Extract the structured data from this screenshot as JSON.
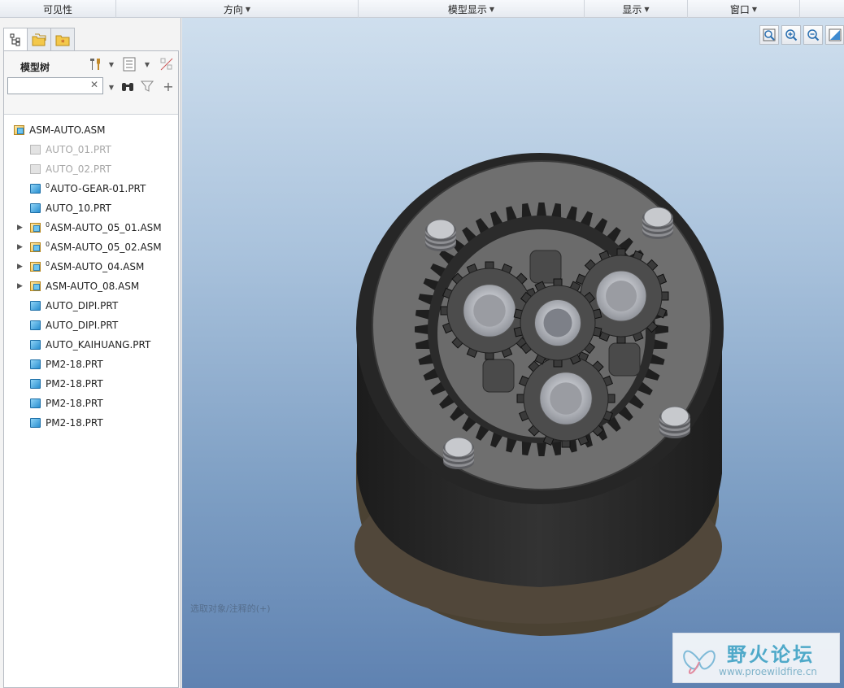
{
  "ribbon": {
    "groups": [
      {
        "label": "可见性",
        "has_dropdown": false
      },
      {
        "label": "方向",
        "has_dropdown": true
      },
      {
        "label": "模型显示",
        "has_dropdown": true
      },
      {
        "label": "显示",
        "has_dropdown": true
      },
      {
        "label": "窗口",
        "has_dropdown": true
      }
    ]
  },
  "sidebar": {
    "tabs": [
      {
        "icon": "model-tree-icon"
      },
      {
        "icon": "folder-browser-icon"
      },
      {
        "icon": "favorites-icon"
      }
    ],
    "tree_title": "模型树",
    "search": {
      "value": "",
      "placeholder": ""
    },
    "tree": [
      {
        "label": "ASM-AUTO.ASM",
        "type": "asm",
        "level": 0,
        "expandable": false,
        "dim": false,
        "marker": ""
      },
      {
        "label": "AUTO_01.PRT",
        "type": "prt",
        "level": 1,
        "expandable": false,
        "dim": true,
        "marker": ""
      },
      {
        "label": "AUTO_02.PRT",
        "type": "prt",
        "level": 1,
        "expandable": false,
        "dim": true,
        "marker": ""
      },
      {
        "label": "AUTO-GEAR-01.PRT",
        "type": "prt",
        "level": 1,
        "expandable": false,
        "dim": false,
        "marker": "0"
      },
      {
        "label": "AUTO_10.PRT",
        "type": "prt",
        "level": 1,
        "expandable": false,
        "dim": false,
        "marker": ""
      },
      {
        "label": "ASM-AUTO_05_01.ASM",
        "type": "asm",
        "level": 1,
        "expandable": true,
        "dim": false,
        "marker": "0"
      },
      {
        "label": "ASM-AUTO_05_02.ASM",
        "type": "asm",
        "level": 1,
        "expandable": true,
        "dim": false,
        "marker": "0"
      },
      {
        "label": "ASM-AUTO_04.ASM",
        "type": "asm",
        "level": 1,
        "expandable": true,
        "dim": false,
        "marker": "0"
      },
      {
        "label": "ASM-AUTO_08.ASM",
        "type": "asm",
        "level": 1,
        "expandable": true,
        "dim": false,
        "marker": ""
      },
      {
        "label": "AUTO_DIPI.PRT",
        "type": "prt",
        "level": 1,
        "expandable": false,
        "dim": false,
        "marker": ""
      },
      {
        "label": "AUTO_DIPI.PRT",
        "type": "prt",
        "level": 1,
        "expandable": false,
        "dim": false,
        "marker": ""
      },
      {
        "label": "AUTO_KAIHUANG.PRT",
        "type": "prt",
        "level": 1,
        "expandable": false,
        "dim": false,
        "marker": ""
      },
      {
        "label": "PM2-18.PRT",
        "type": "prt",
        "level": 1,
        "expandable": false,
        "dim": false,
        "marker": ""
      },
      {
        "label": "PM2-18.PRT",
        "type": "prt",
        "level": 1,
        "expandable": false,
        "dim": false,
        "marker": ""
      },
      {
        "label": "PM2-18.PRT",
        "type": "prt",
        "level": 1,
        "expandable": false,
        "dim": false,
        "marker": ""
      },
      {
        "label": "PM2-18.PRT",
        "type": "prt",
        "level": 1,
        "expandable": false,
        "dim": false,
        "marker": ""
      }
    ]
  },
  "viewport": {
    "tools": [
      "refit-icon",
      "zoom-in-icon",
      "zoom-out-icon",
      "repaint-icon"
    ],
    "status_hint": "选取对象/注释的(+)"
  },
  "watermark": {
    "title": "野火论坛",
    "url": "www.proewildfire.cn"
  },
  "colors": {
    "viewport_top": "#cfdfee",
    "viewport_bottom": "#5f82b1",
    "housing": "#2b2b2b",
    "face": "#6d6d6d",
    "gear_light": "#c9ccd3"
  }
}
